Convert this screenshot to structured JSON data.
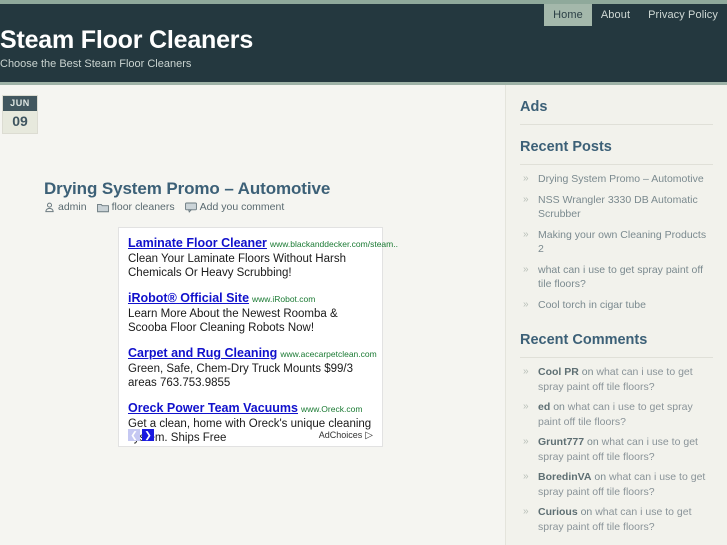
{
  "header": {
    "title": "Steam Floor Cleaners",
    "tagline": "Choose the Best Steam Floor Cleaners",
    "nav": [
      {
        "label": "Home",
        "active": true
      },
      {
        "label": "About",
        "active": false
      },
      {
        "label": "Privacy Policy",
        "active": false
      }
    ],
    "colors": {
      "background": "#24383f",
      "accent_strip": "#8fa99b",
      "active_tab": "#a4b8ab"
    }
  },
  "post": {
    "date": {
      "month": "JUN",
      "day": "09"
    },
    "title": "Drying System Promo – Automotive",
    "meta": [
      {
        "icon": "user-icon",
        "label": "admin"
      },
      {
        "icon": "folder-icon",
        "label": "floor cleaners"
      },
      {
        "icon": "comment-icon",
        "label": "Add you comment"
      }
    ],
    "title_color": "#3c6077"
  },
  "ads": {
    "units": [
      {
        "title": "Laminate Floor Cleaner",
        "url": "www.blackanddecker.com/steam..",
        "description": "Clean Your Laminate Floors Without Harsh Chemicals Or Heavy Scrubbing!"
      },
      {
        "title": "iRobot® Official Site",
        "url": "www.iRobot.com",
        "description": "Learn More About the Newest Roomba & Scooba Floor Cleaning Robots Now!"
      },
      {
        "title": "Carpet and Rug Cleaning",
        "url": "www.acecarpetclean.com",
        "description": "Green, Safe, Chem-Dry Truck Mounts $99/3 areas 763.753.9855"
      },
      {
        "title": "Oreck Power Team Vacuums",
        "url": "www.Oreck.com",
        "description": "Get a clean, home with Oreck's unique cleaning system. Ships Free"
      }
    ],
    "pager": {
      "prev": "❮",
      "next": "❯"
    },
    "adchoices_label": "AdChoices",
    "adchoices_glyph": "▷",
    "link_color": "#1111cc",
    "url_color": "#1a7a33"
  },
  "sidebar": {
    "widgets": [
      {
        "title": "Ads",
        "type": "empty",
        "items": []
      },
      {
        "title": "Recent Posts",
        "type": "links",
        "items": [
          "Drying System Promo – Automotive",
          "NSS Wrangler 3330 DB Automatic Scrubber",
          "Making your own Cleaning Products 2",
          "what can i use to get spray paint off tile floors?",
          "Cool torch in cigar tube"
        ]
      },
      {
        "title": "Recent Comments",
        "type": "comments",
        "items": [
          {
            "author": "Cool PR",
            "on": "on",
            "post": "what can i use to get spray paint off tile floors?"
          },
          {
            "author": "ed",
            "on": "on",
            "post": "what can i use to get spray paint off tile floors?"
          },
          {
            "author": "Grunt777",
            "on": "on",
            "post": "what can i use to get spray paint off tile floors?"
          },
          {
            "author": "BoredinVA",
            "on": "on",
            "post": "what can i use to get spray paint off tile floors?"
          },
          {
            "author": "Curious",
            "on": "on",
            "post": "what can i use to get spray paint off tile floors?"
          }
        ]
      }
    ],
    "bullet": "»",
    "heading_color": "#3c6077"
  }
}
